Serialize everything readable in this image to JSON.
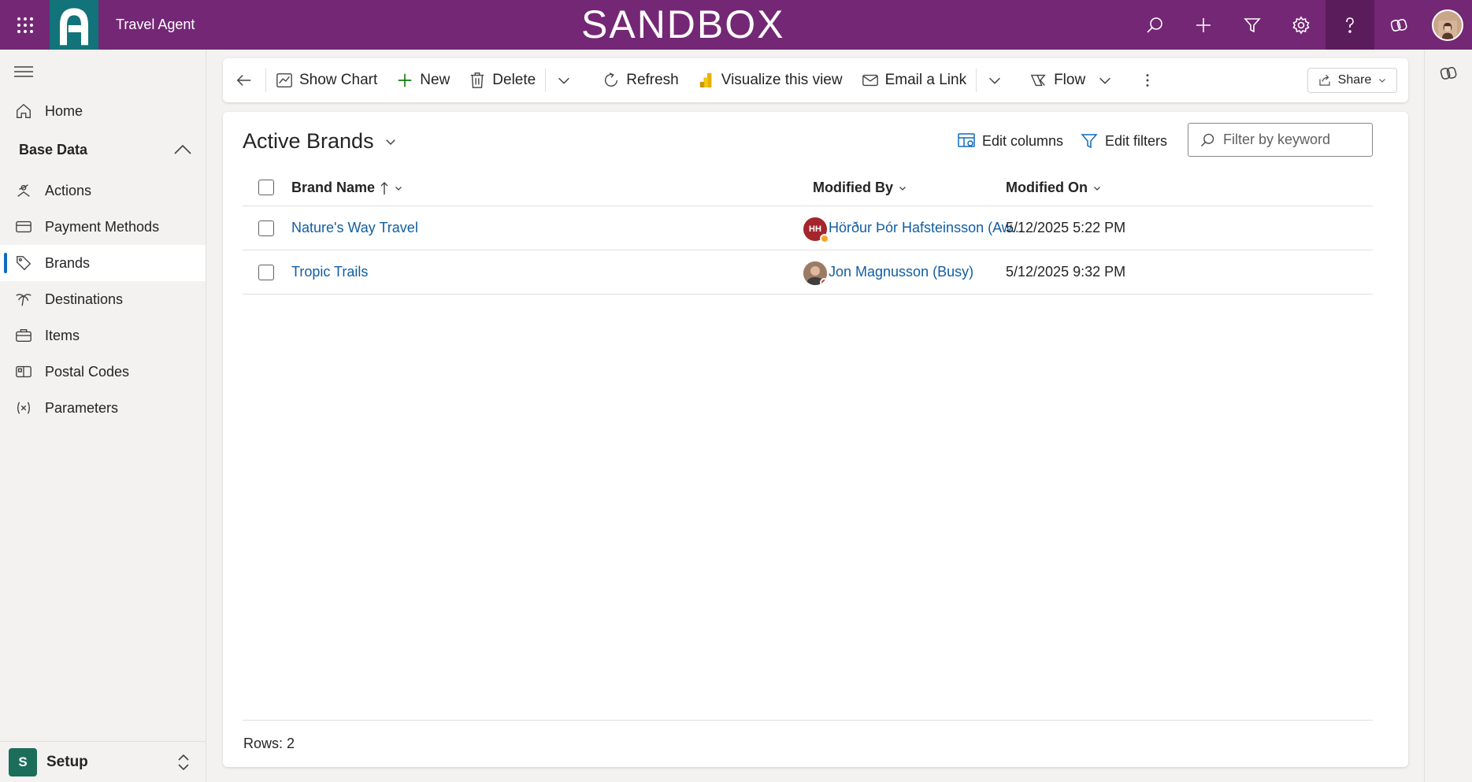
{
  "topbar": {
    "app_name": "Travel Agent",
    "environment_label": "SANDBOX",
    "colors": {
      "bar": "#742774",
      "logo_tile": "#12737a"
    }
  },
  "sidebar": {
    "home_label": "Home",
    "group_label": "Base Data",
    "items": [
      {
        "label": "Actions",
        "icon": "actions-icon"
      },
      {
        "label": "Payment Methods",
        "icon": "payment-methods-icon"
      },
      {
        "label": "Brands",
        "icon": "tag-icon",
        "selected": true
      },
      {
        "label": "Destinations",
        "icon": "palm-tree-icon"
      },
      {
        "label": "Items",
        "icon": "briefcase-icon"
      },
      {
        "label": "Postal Codes",
        "icon": "postal-code-icon"
      },
      {
        "label": "Parameters",
        "icon": "variable-icon"
      }
    ],
    "area": {
      "badge": "S",
      "label": "Setup"
    }
  },
  "commandbar": {
    "show_chart": "Show Chart",
    "new": "New",
    "delete": "Delete",
    "refresh": "Refresh",
    "visualize": "Visualize this view",
    "email_link": "Email a Link",
    "flow": "Flow",
    "share": "Share"
  },
  "view": {
    "title": "Active Brands",
    "edit_columns": "Edit columns",
    "edit_filters": "Edit filters",
    "filter_placeholder": "Filter by keyword",
    "columns": {
      "brand_name": "Brand Name",
      "modified_by": "Modified By",
      "modified_on": "Modified On"
    },
    "rows": [
      {
        "brand_name": "Nature's Way Travel",
        "modified_by": "Hörður Þór Hafsteinsson (Aw...",
        "initials": "HH",
        "presence_color": "#f8a32e",
        "modified_on": "5/12/2025 5:22 PM"
      },
      {
        "brand_name": "Tropic Trails",
        "modified_by": "Jon Magnusson (Busy)",
        "initials": "",
        "presence_color": "#d13438",
        "modified_on": "5/12/2025 9:32 PM"
      }
    ],
    "rows_count": "Rows: 2"
  }
}
